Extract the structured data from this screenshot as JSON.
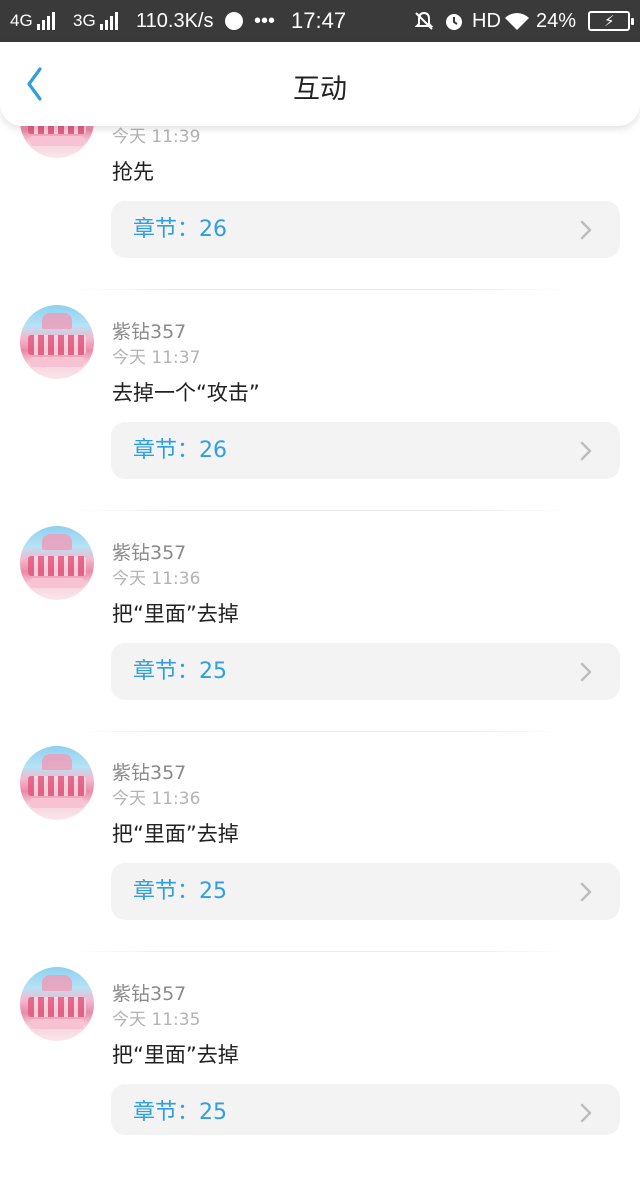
{
  "status_bar": {
    "net1": "4G",
    "net2": "3G",
    "speed": "110.3K/s",
    "more": "•••",
    "time": "17:47",
    "hd": "HD",
    "battery": "24%"
  },
  "header": {
    "title": "互动",
    "back_icon": "chevron-left-icon"
  },
  "items": [
    {
      "username": "",
      "time": "今天 11:39",
      "content": "抢先",
      "chapter": "章节：26"
    },
    {
      "username": "紫钻357",
      "time": "今天 11:37",
      "content": "去掉一个“攻击”",
      "chapter": "章节：26"
    },
    {
      "username": "紫钻357",
      "time": "今天 11:36",
      "content": "把“里面”去掉",
      "chapter": "章节：25"
    },
    {
      "username": "紫钻357",
      "time": "今天 11:36",
      "content": "把“里面”去掉",
      "chapter": "章节：25"
    },
    {
      "username": "紫钻357",
      "time": "今天 11:35",
      "content": "把“里面”去掉",
      "chapter": "章节：25"
    }
  ],
  "colors": {
    "accent": "#2f9fdf",
    "status_bar": "#3a3a3a",
    "chapter_bg": "#f3f3f3"
  }
}
